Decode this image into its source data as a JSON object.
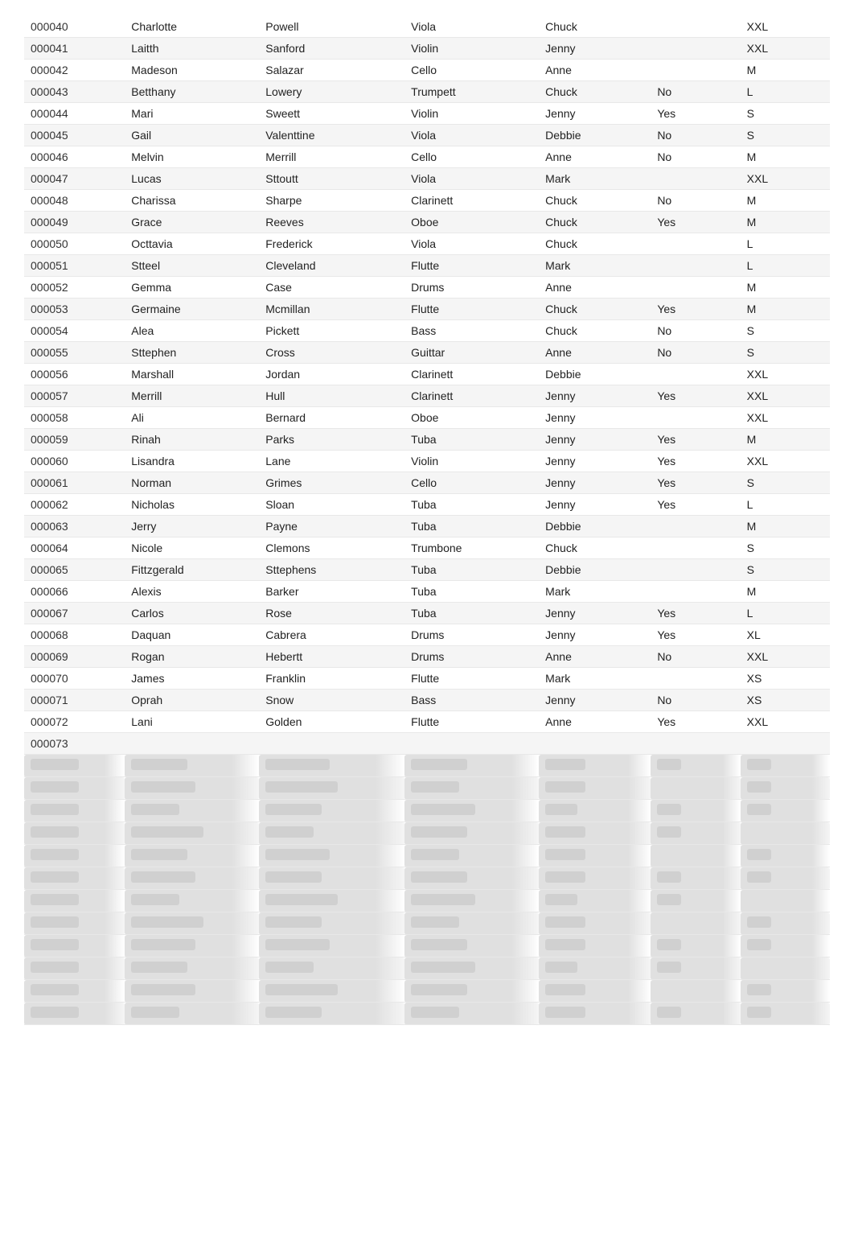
{
  "table": {
    "rows": [
      {
        "id": "000040",
        "first": "Charlotte",
        "last": "Powell",
        "instrument": "Viola",
        "teacher": "Chuck",
        "active": "",
        "size": "XXL"
      },
      {
        "id": "000041",
        "first": "Laitth",
        "last": "Sanford",
        "instrument": "Violin",
        "teacher": "Jenny",
        "active": "",
        "size": "XXL"
      },
      {
        "id": "000042",
        "first": "Madeson",
        "last": "Salazar",
        "instrument": "Cello",
        "teacher": "Anne",
        "active": "",
        "size": "M"
      },
      {
        "id": "000043",
        "first": "Betthany",
        "last": "Lowery",
        "instrument": "Trumpett",
        "teacher": "Chuck",
        "active": "No",
        "size": "L"
      },
      {
        "id": "000044",
        "first": "Mari",
        "last": "Sweett",
        "instrument": "Violin",
        "teacher": "Jenny",
        "active": "Yes",
        "size": "S"
      },
      {
        "id": "000045",
        "first": "Gail",
        "last": "Valenttine",
        "instrument": "Viola",
        "teacher": "Debbie",
        "active": "No",
        "size": "S"
      },
      {
        "id": "000046",
        "first": "Melvin",
        "last": "Merrill",
        "instrument": "Cello",
        "teacher": "Anne",
        "active": "No",
        "size": "M"
      },
      {
        "id": "000047",
        "first": "Lucas",
        "last": "Sttoutt",
        "instrument": "Viola",
        "teacher": "Mark",
        "active": "",
        "size": "XXL"
      },
      {
        "id": "000048",
        "first": "Charissa",
        "last": "Sharpe",
        "instrument": "Clarinett",
        "teacher": "Chuck",
        "active": "No",
        "size": "M"
      },
      {
        "id": "000049",
        "first": "Grace",
        "last": "Reeves",
        "instrument": "Oboe",
        "teacher": "Chuck",
        "active": "Yes",
        "size": "M"
      },
      {
        "id": "000050",
        "first": "Octtavia",
        "last": "Frederick",
        "instrument": "Viola",
        "teacher": "Chuck",
        "active": "",
        "size": "L"
      },
      {
        "id": "000051",
        "first": "Stteel",
        "last": "Cleveland",
        "instrument": "Flutte",
        "teacher": "Mark",
        "active": "",
        "size": "L"
      },
      {
        "id": "000052",
        "first": "Gemma",
        "last": "Case",
        "instrument": "Drums",
        "teacher": "Anne",
        "active": "",
        "size": "M"
      },
      {
        "id": "000053",
        "first": "Germaine",
        "last": "Mcmillan",
        "instrument": "Flutte",
        "teacher": "Chuck",
        "active": "Yes",
        "size": "M"
      },
      {
        "id": "000054",
        "first": "Alea",
        "last": "Pickett",
        "instrument": "Bass",
        "teacher": "Chuck",
        "active": "No",
        "size": "S"
      },
      {
        "id": "000055",
        "first": "Sttephen",
        "last": "Cross",
        "instrument": "Guittar",
        "teacher": "Anne",
        "active": "No",
        "size": "S"
      },
      {
        "id": "000056",
        "first": "Marshall",
        "last": "Jordan",
        "instrument": "Clarinett",
        "teacher": "Debbie",
        "active": "",
        "size": "XXL"
      },
      {
        "id": "000057",
        "first": "Merrill",
        "last": "Hull",
        "instrument": "Clarinett",
        "teacher": "Jenny",
        "active": "Yes",
        "size": "XXL"
      },
      {
        "id": "000058",
        "first": "Ali",
        "last": "Bernard",
        "instrument": "Oboe",
        "teacher": "Jenny",
        "active": "",
        "size": "XXL"
      },
      {
        "id": "000059",
        "first": "Rinah",
        "last": "Parks",
        "instrument": "Tuba",
        "teacher": "Jenny",
        "active": "Yes",
        "size": "M"
      },
      {
        "id": "000060",
        "first": "Lisandra",
        "last": "Lane",
        "instrument": "Violin",
        "teacher": "Jenny",
        "active": "Yes",
        "size": "XXL"
      },
      {
        "id": "000061",
        "first": "Norman",
        "last": "Grimes",
        "instrument": "Cello",
        "teacher": "Jenny",
        "active": "Yes",
        "size": "S"
      },
      {
        "id": "000062",
        "first": "Nicholas",
        "last": "Sloan",
        "instrument": "Tuba",
        "teacher": "Jenny",
        "active": "Yes",
        "size": "L"
      },
      {
        "id": "000063",
        "first": "Jerry",
        "last": "Payne",
        "instrument": "Tuba",
        "teacher": "Debbie",
        "active": "",
        "size": "M"
      },
      {
        "id": "000064",
        "first": "Nicole",
        "last": "Clemons",
        "instrument": "Trumbone",
        "teacher": "Chuck",
        "active": "",
        "size": "S"
      },
      {
        "id": "000065",
        "first": "Fittzgerald",
        "last": "Sttephens",
        "instrument": "Tuba",
        "teacher": "Debbie",
        "active": "",
        "size": "S"
      },
      {
        "id": "000066",
        "first": "Alexis",
        "last": "Barker",
        "instrument": "Tuba",
        "teacher": "Mark",
        "active": "",
        "size": "M"
      },
      {
        "id": "000067",
        "first": "Carlos",
        "last": "Rose",
        "instrument": "Tuba",
        "teacher": "Jenny",
        "active": "Yes",
        "size": "L"
      },
      {
        "id": "000068",
        "first": "Daquan",
        "last": "Cabrera",
        "instrument": "Drums",
        "teacher": "Jenny",
        "active": "Yes",
        "size": "XL"
      },
      {
        "id": "000069",
        "first": "Rogan",
        "last": "Hebertt",
        "instrument": "Drums",
        "teacher": "Anne",
        "active": "No",
        "size": "XXL"
      },
      {
        "id": "000070",
        "first": "James",
        "last": "Franklin",
        "instrument": "Flutte",
        "teacher": "Mark",
        "active": "",
        "size": "XS"
      },
      {
        "id": "000071",
        "first": "Oprah",
        "last": "Snow",
        "instrument": "Bass",
        "teacher": "Jenny",
        "active": "No",
        "size": "XS"
      },
      {
        "id": "000072",
        "first": "Lani",
        "last": "Golden",
        "instrument": "Flutte",
        "teacher": "Anne",
        "active": "Yes",
        "size": "XXL"
      },
      {
        "id": "000073",
        "first": "",
        "last": "",
        "instrument": "",
        "teacher": "",
        "active": "",
        "size": ""
      }
    ]
  }
}
